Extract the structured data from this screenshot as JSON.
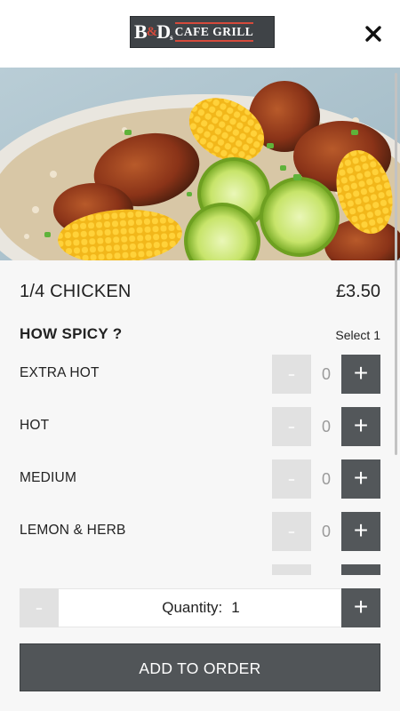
{
  "header": {
    "logo": {
      "bd": "B",
      "amp": "&",
      "d": "D",
      "s": "s",
      "cafe_grill": "CAFE GRILL"
    },
    "close_icon": "close-icon"
  },
  "hero": {
    "alt": "Grilled chicken with corn on the cob, limes and rice"
  },
  "item": {
    "name": "1/4 CHICKEN",
    "price": "£3.50"
  },
  "option_group": {
    "title": "HOW SPICY ?",
    "select_hint": "Select 1",
    "options": [
      {
        "label": "EXTRA HOT",
        "count": "0",
        "minus": "-",
        "plus": "+"
      },
      {
        "label": "HOT",
        "count": "0",
        "minus": "-",
        "plus": "+"
      },
      {
        "label": "MEDIUM",
        "count": "0",
        "minus": "-",
        "plus": "+"
      },
      {
        "label": "LEMON & HERB",
        "count": "0",
        "minus": "-",
        "plus": "+"
      },
      {
        "label": "",
        "count": "",
        "minus": "-",
        "plus": "+"
      }
    ]
  },
  "quantity": {
    "label": "Quantity:",
    "value": "1",
    "minus": "-",
    "plus": "+"
  },
  "add_button": {
    "label": "ADD TO ORDER"
  },
  "colors": {
    "dark_button": "#53575a",
    "disabled_button": "#e1e1e1",
    "logo_accent": "#d64a3b",
    "background": "#f7f7f7"
  }
}
